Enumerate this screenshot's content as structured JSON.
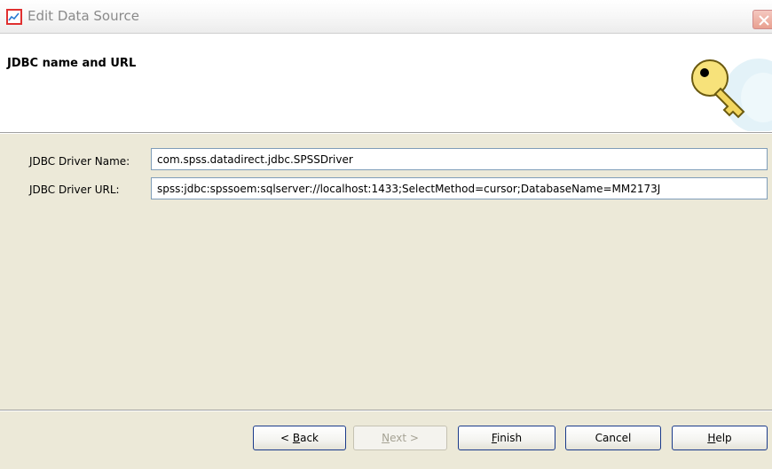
{
  "window": {
    "title": "Edit Data Source",
    "app_icon": "chart-icon",
    "close_icon": "close-icon"
  },
  "header": {
    "title": "JDBC name and URL",
    "graphic": "key-icon"
  },
  "form": {
    "driver_name_label": "JDBC Driver Name:",
    "driver_name_value": "com.spss.datadirect.jdbc.SPSSDriver",
    "driver_url_label": "JDBC Driver URL:",
    "driver_url_value": "spss:jdbc:spssoem:sqlserver://localhost:1433;SelectMethod=cursor;DatabaseName=MM2173J"
  },
  "buttons": {
    "back_mnemonic": "B",
    "back_rest": "ack",
    "back_prefix": "< ",
    "next_mnemonic": "N",
    "next_rest": "ext >",
    "finish_mnemonic": "F",
    "finish_rest": "inish",
    "cancel": "Cancel",
    "help_mnemonic": "H",
    "help_rest": "elp"
  }
}
